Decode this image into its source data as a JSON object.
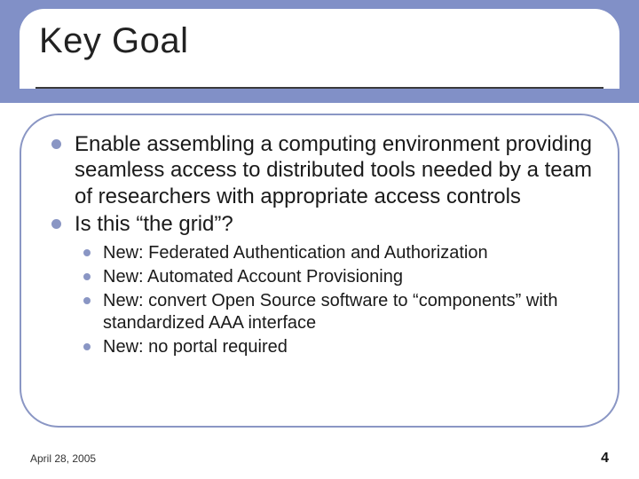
{
  "title": "Key Goal",
  "bullets": [
    {
      "text": "Enable assembling a computing environment providing seamless access to distributed tools needed by a team of researchers with appropriate access controls"
    },
    {
      "text": "Is this “the grid”?"
    }
  ],
  "sub_bullets": [
    {
      "text": "New: Federated Authentication and Authorization"
    },
    {
      "text": "New: Automated Account Provisioning"
    },
    {
      "text": "New: convert Open Source software to “components” with standardized AAA interface"
    },
    {
      "text": "New: no portal required"
    }
  ],
  "footer": {
    "date": "April 28, 2005",
    "page": "4"
  },
  "colors": {
    "accent": "#8190c7",
    "border": "#8a96c4"
  }
}
